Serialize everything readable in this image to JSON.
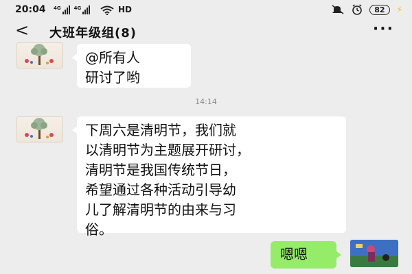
{
  "status_bar": {
    "time": "20:04",
    "signal1_label": "4G",
    "signal2_label": "4G",
    "network_label": "HD",
    "battery": "82"
  },
  "header": {
    "back_icon": "chevron-left-icon",
    "back_glyph": "<",
    "title": "大班年级组(8)",
    "more_glyph": "···"
  },
  "messages": [
    {
      "direction": "incoming",
      "lines": [
        "@所有人",
        "研讨了哟"
      ]
    },
    {
      "type": "timestamp",
      "text": "14:14"
    },
    {
      "direction": "incoming",
      "lines": [
        "下周六是清明节，我们就",
        "以清明节为主题展开研讨，",
        "清明节是我国传统节日，",
        "希望通过各种活动引导幼",
        "儿了解清明节的由来与习",
        "俗。"
      ]
    },
    {
      "direction": "outgoing",
      "lines": [
        "嗯嗯"
      ]
    }
  ],
  "colors": {
    "background": "#ededed",
    "bubble_in": "#ffffff",
    "bubble_out": "#95ec69",
    "charging_bolt": "#f2c200"
  }
}
